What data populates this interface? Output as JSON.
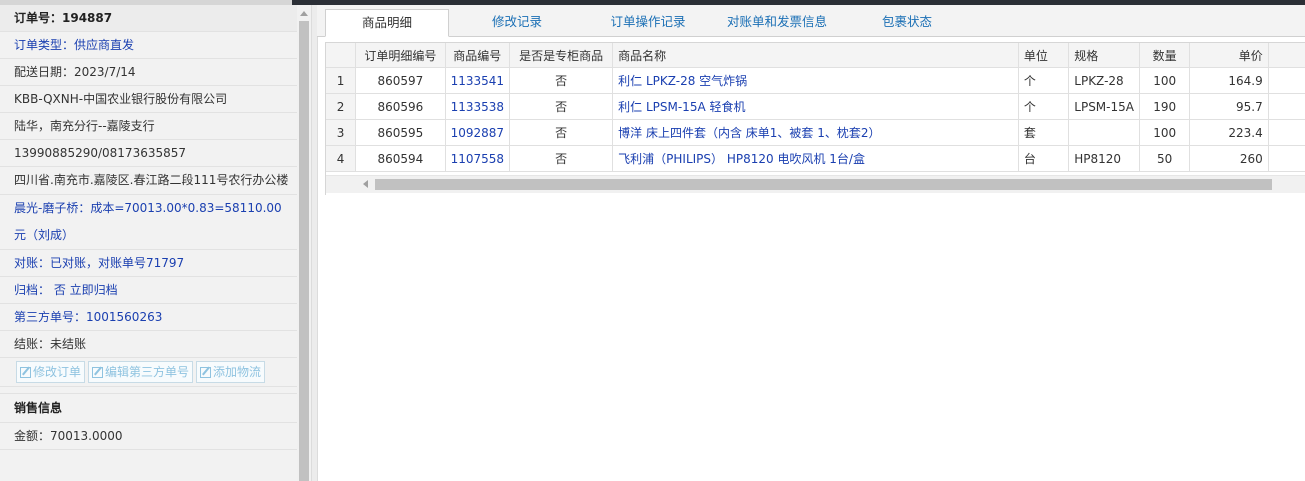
{
  "order": {
    "number_label": "订单号：194887",
    "type": "订单类型：供应商直发",
    "delivery_date": "配送日期：2023/7/14",
    "customer": "KBB-QXNH-中国农业银行股份有限公司",
    "contact": "陆华，南充分行--嘉陵支行",
    "phone": "13990885290/08173635857",
    "address": "四川省.南充市.嘉陵区.春江路二段111号农行办公楼",
    "cost_note": "晨光-磨子桥：成本=70013.00*0.83=58110.00元（刘成）",
    "reconcile": "对账：已对账，对账单号71797",
    "archive": "归档： 否 立即归档",
    "third_party": "第三方单号：1001560263",
    "settlement": "结账：未结账"
  },
  "buttons": {
    "edit_order": "修改订单",
    "edit_third_party": "编辑第三方单号",
    "add_logistics": "添加物流"
  },
  "sales": {
    "title": "销售信息",
    "amount": "金额：70013.0000"
  },
  "tabs": [
    {
      "label": "商品明细"
    },
    {
      "label": "修改记录"
    },
    {
      "label": "订单操作记录"
    },
    {
      "label": "对账单和发票信息"
    },
    {
      "label": "包裹状态"
    }
  ],
  "grid": {
    "columns": [
      "订单明细编号",
      "商品编号",
      "是否是专柜商品",
      "商品名称",
      "单位",
      "规格",
      "数量",
      "单价"
    ],
    "rows": [
      {
        "idx": "1",
        "detail_no": "860597",
        "product_no": "1133541",
        "counter": "否",
        "name": "利仁 LPKZ-28 空气炸锅",
        "unit": "个",
        "spec": "LPKZ-28",
        "qty": "100",
        "price": "164.9"
      },
      {
        "idx": "2",
        "detail_no": "860596",
        "product_no": "1133538",
        "counter": "否",
        "name": "利仁 LPSM-15A 轻食机",
        "unit": "个",
        "spec": "LPSM-15A",
        "qty": "190",
        "price": "95.7"
      },
      {
        "idx": "3",
        "detail_no": "860595",
        "product_no": "1092887",
        "counter": "否",
        "name": "博洋 床上四件套（内含 床单1、被套 1、枕套2）",
        "unit": "套",
        "spec": "",
        "qty": "100",
        "price": "223.4"
      },
      {
        "idx": "4",
        "detail_no": "860594",
        "product_no": "1107558",
        "counter": "否",
        "name": "飞利浦（PHILIPS） HP8120 电吹风机 1台/盒",
        "unit": "台",
        "spec": "HP8120",
        "qty": "50",
        "price": "260"
      }
    ]
  }
}
